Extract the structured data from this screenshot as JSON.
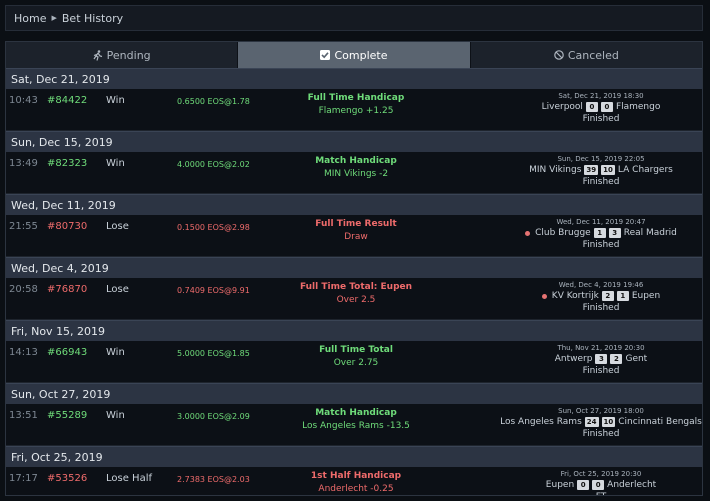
{
  "breadcrumb": {
    "home": "Home",
    "current": "Bet History"
  },
  "tabs": [
    {
      "label": "Pending",
      "icon": "running-icon",
      "active": false
    },
    {
      "label": "Complete",
      "icon": "checkbox-icon",
      "active": true
    },
    {
      "label": "Canceled",
      "icon": "ban-icon",
      "active": false
    }
  ],
  "colors": {
    "win": "#6fdc7a",
    "lose": "#ee6b6b",
    "active_tab": "#5a6470",
    "day_header": "#2c3443"
  },
  "days": [
    {
      "date": "Sat, Dec 21, 2019",
      "bet": {
        "time": "10:43",
        "id": "#84422",
        "result": "Win",
        "outcome": "win",
        "stake": "0.6500 EOS@1.78",
        "market": "Full Time Handicap",
        "pick": "Flamengo +1.25",
        "match_time": "Sat, Dec 21, 2019 18:30",
        "home": "Liverpool",
        "home_score": "0",
        "away_score": "0",
        "away": "Flamengo",
        "live_dot": false,
        "status": "Finished"
      }
    },
    {
      "date": "Sun, Dec 15, 2019",
      "bet": {
        "time": "13:49",
        "id": "#82323",
        "result": "Win",
        "outcome": "win",
        "stake": "4.0000 EOS@2.02",
        "market": "Match Handicap",
        "pick": "MIN Vikings -2",
        "match_time": "Sun, Dec 15, 2019 22:05",
        "home": "MIN Vikings",
        "home_score": "39",
        "away_score": "10",
        "away": "LA Chargers",
        "live_dot": false,
        "status": "Finished"
      }
    },
    {
      "date": "Wed, Dec 11, 2019",
      "bet": {
        "time": "21:55",
        "id": "#80730",
        "result": "Lose",
        "outcome": "lose",
        "stake": "0.1500 EOS@2.98",
        "market": "Full Time Result",
        "pick": "Draw",
        "match_time": "Wed, Dec 11, 2019 20:47",
        "home": "Club Brugge",
        "home_score": "1",
        "away_score": "3",
        "away": "Real Madrid",
        "live_dot": true,
        "status": "Finished"
      }
    },
    {
      "date": "Wed, Dec 4, 2019",
      "bet": {
        "time": "20:58",
        "id": "#76870",
        "result": "Lose",
        "outcome": "lose",
        "stake": "0.7409 EOS@9.91",
        "market": "Full Time Total: Eupen",
        "pick": "Over 2.5",
        "match_time": "Wed, Dec 4, 2019 19:46",
        "home": "KV Kortrijk",
        "home_score": "2",
        "away_score": "1",
        "away": "Eupen",
        "live_dot": true,
        "status": "Finished"
      }
    },
    {
      "date": "Fri, Nov 15, 2019",
      "bet": {
        "time": "14:13",
        "id": "#66943",
        "result": "Win",
        "outcome": "win",
        "stake": "5.0000 EOS@1.85",
        "market": "Full Time Total",
        "pick": "Over 2.75",
        "match_time": "Thu, Nov 21, 2019 20:30",
        "home": "Antwerp",
        "home_score": "3",
        "away_score": "2",
        "away": "Gent",
        "live_dot": false,
        "status": "Finished"
      }
    },
    {
      "date": "Sun, Oct 27, 2019",
      "bet": {
        "time": "13:51",
        "id": "#55289",
        "result": "Win",
        "outcome": "win",
        "stake": "3.0000 EOS@2.09",
        "market": "Match Handicap",
        "pick": "Los Angeles Rams -13.5",
        "match_time": "Sun, Oct 27, 2019 18:00",
        "home": "Los Angeles Rams",
        "home_score": "24",
        "away_score": "10",
        "away": "Cincinnati Bengals",
        "live_dot": false,
        "status": "Finished"
      }
    },
    {
      "date": "Fri, Oct 25, 2019",
      "bet": {
        "time": "17:17",
        "id": "#53526",
        "result": "Lose Half",
        "outcome": "lose",
        "stake": "2.7383 EOS@2.03",
        "market": "1st Half Handicap",
        "pick": "Anderlecht -0.25",
        "match_time": "Fri, Oct 25, 2019 20:30",
        "home": "Eupen",
        "home_score": "0",
        "away_score": "0",
        "away": "Anderlecht",
        "live_dot": false,
        "status": "FT"
      }
    }
  ]
}
